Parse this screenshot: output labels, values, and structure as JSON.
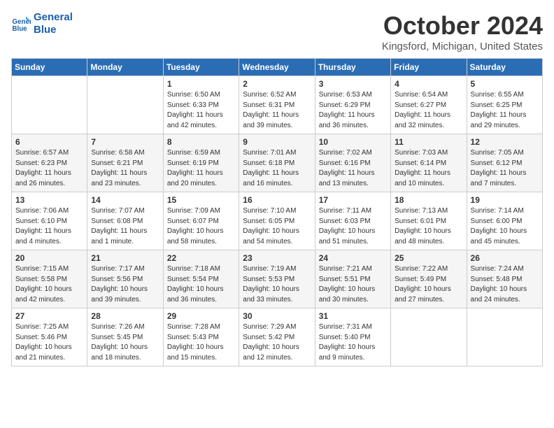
{
  "header": {
    "logo_line1": "General",
    "logo_line2": "Blue",
    "month": "October 2024",
    "location": "Kingsford, Michigan, United States"
  },
  "weekdays": [
    "Sunday",
    "Monday",
    "Tuesday",
    "Wednesday",
    "Thursday",
    "Friday",
    "Saturday"
  ],
  "weeks": [
    [
      {
        "day": "",
        "sunrise": "",
        "sunset": "",
        "daylight": ""
      },
      {
        "day": "",
        "sunrise": "",
        "sunset": "",
        "daylight": ""
      },
      {
        "day": "1",
        "sunrise": "Sunrise: 6:50 AM",
        "sunset": "Sunset: 6:33 PM",
        "daylight": "Daylight: 11 hours and 42 minutes."
      },
      {
        "day": "2",
        "sunrise": "Sunrise: 6:52 AM",
        "sunset": "Sunset: 6:31 PM",
        "daylight": "Daylight: 11 hours and 39 minutes."
      },
      {
        "day": "3",
        "sunrise": "Sunrise: 6:53 AM",
        "sunset": "Sunset: 6:29 PM",
        "daylight": "Daylight: 11 hours and 36 minutes."
      },
      {
        "day": "4",
        "sunrise": "Sunrise: 6:54 AM",
        "sunset": "Sunset: 6:27 PM",
        "daylight": "Daylight: 11 hours and 32 minutes."
      },
      {
        "day": "5",
        "sunrise": "Sunrise: 6:55 AM",
        "sunset": "Sunset: 6:25 PM",
        "daylight": "Daylight: 11 hours and 29 minutes."
      }
    ],
    [
      {
        "day": "6",
        "sunrise": "Sunrise: 6:57 AM",
        "sunset": "Sunset: 6:23 PM",
        "daylight": "Daylight: 11 hours and 26 minutes."
      },
      {
        "day": "7",
        "sunrise": "Sunrise: 6:58 AM",
        "sunset": "Sunset: 6:21 PM",
        "daylight": "Daylight: 11 hours and 23 minutes."
      },
      {
        "day": "8",
        "sunrise": "Sunrise: 6:59 AM",
        "sunset": "Sunset: 6:19 PM",
        "daylight": "Daylight: 11 hours and 20 minutes."
      },
      {
        "day": "9",
        "sunrise": "Sunrise: 7:01 AM",
        "sunset": "Sunset: 6:18 PM",
        "daylight": "Daylight: 11 hours and 16 minutes."
      },
      {
        "day": "10",
        "sunrise": "Sunrise: 7:02 AM",
        "sunset": "Sunset: 6:16 PM",
        "daylight": "Daylight: 11 hours and 13 minutes."
      },
      {
        "day": "11",
        "sunrise": "Sunrise: 7:03 AM",
        "sunset": "Sunset: 6:14 PM",
        "daylight": "Daylight: 11 hours and 10 minutes."
      },
      {
        "day": "12",
        "sunrise": "Sunrise: 7:05 AM",
        "sunset": "Sunset: 6:12 PM",
        "daylight": "Daylight: 11 hours and 7 minutes."
      }
    ],
    [
      {
        "day": "13",
        "sunrise": "Sunrise: 7:06 AM",
        "sunset": "Sunset: 6:10 PM",
        "daylight": "Daylight: 11 hours and 4 minutes."
      },
      {
        "day": "14",
        "sunrise": "Sunrise: 7:07 AM",
        "sunset": "Sunset: 6:08 PM",
        "daylight": "Daylight: 11 hours and 1 minute."
      },
      {
        "day": "15",
        "sunrise": "Sunrise: 7:09 AM",
        "sunset": "Sunset: 6:07 PM",
        "daylight": "Daylight: 10 hours and 58 minutes."
      },
      {
        "day": "16",
        "sunrise": "Sunrise: 7:10 AM",
        "sunset": "Sunset: 6:05 PM",
        "daylight": "Daylight: 10 hours and 54 minutes."
      },
      {
        "day": "17",
        "sunrise": "Sunrise: 7:11 AM",
        "sunset": "Sunset: 6:03 PM",
        "daylight": "Daylight: 10 hours and 51 minutes."
      },
      {
        "day": "18",
        "sunrise": "Sunrise: 7:13 AM",
        "sunset": "Sunset: 6:01 PM",
        "daylight": "Daylight: 10 hours and 48 minutes."
      },
      {
        "day": "19",
        "sunrise": "Sunrise: 7:14 AM",
        "sunset": "Sunset: 6:00 PM",
        "daylight": "Daylight: 10 hours and 45 minutes."
      }
    ],
    [
      {
        "day": "20",
        "sunrise": "Sunrise: 7:15 AM",
        "sunset": "Sunset: 5:58 PM",
        "daylight": "Daylight: 10 hours and 42 minutes."
      },
      {
        "day": "21",
        "sunrise": "Sunrise: 7:17 AM",
        "sunset": "Sunset: 5:56 PM",
        "daylight": "Daylight: 10 hours and 39 minutes."
      },
      {
        "day": "22",
        "sunrise": "Sunrise: 7:18 AM",
        "sunset": "Sunset: 5:54 PM",
        "daylight": "Daylight: 10 hours and 36 minutes."
      },
      {
        "day": "23",
        "sunrise": "Sunrise: 7:19 AM",
        "sunset": "Sunset: 5:53 PM",
        "daylight": "Daylight: 10 hours and 33 minutes."
      },
      {
        "day": "24",
        "sunrise": "Sunrise: 7:21 AM",
        "sunset": "Sunset: 5:51 PM",
        "daylight": "Daylight: 10 hours and 30 minutes."
      },
      {
        "day": "25",
        "sunrise": "Sunrise: 7:22 AM",
        "sunset": "Sunset: 5:49 PM",
        "daylight": "Daylight: 10 hours and 27 minutes."
      },
      {
        "day": "26",
        "sunrise": "Sunrise: 7:24 AM",
        "sunset": "Sunset: 5:48 PM",
        "daylight": "Daylight: 10 hours and 24 minutes."
      }
    ],
    [
      {
        "day": "27",
        "sunrise": "Sunrise: 7:25 AM",
        "sunset": "Sunset: 5:46 PM",
        "daylight": "Daylight: 10 hours and 21 minutes."
      },
      {
        "day": "28",
        "sunrise": "Sunrise: 7:26 AM",
        "sunset": "Sunset: 5:45 PM",
        "daylight": "Daylight: 10 hours and 18 minutes."
      },
      {
        "day": "29",
        "sunrise": "Sunrise: 7:28 AM",
        "sunset": "Sunset: 5:43 PM",
        "daylight": "Daylight: 10 hours and 15 minutes."
      },
      {
        "day": "30",
        "sunrise": "Sunrise: 7:29 AM",
        "sunset": "Sunset: 5:42 PM",
        "daylight": "Daylight: 10 hours and 12 minutes."
      },
      {
        "day": "31",
        "sunrise": "Sunrise: 7:31 AM",
        "sunset": "Sunset: 5:40 PM",
        "daylight": "Daylight: 10 hours and 9 minutes."
      },
      {
        "day": "",
        "sunrise": "",
        "sunset": "",
        "daylight": ""
      },
      {
        "day": "",
        "sunrise": "",
        "sunset": "",
        "daylight": ""
      }
    ]
  ]
}
